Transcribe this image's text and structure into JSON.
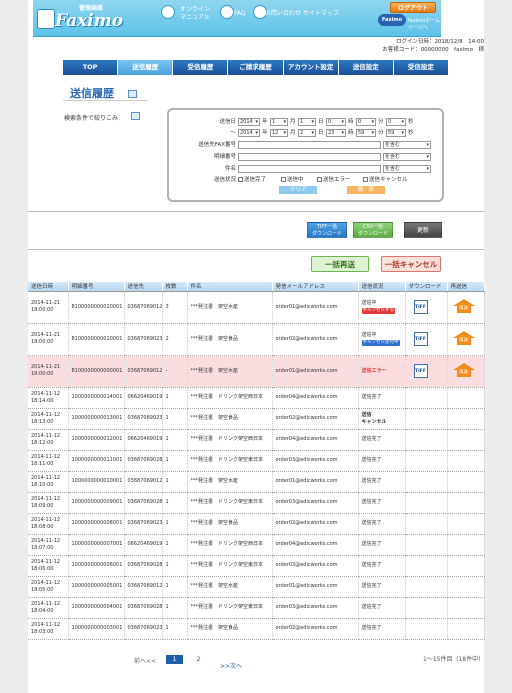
{
  "header": {
    "title_kanri": "管理画面",
    "title_logo": "Faximo",
    "nav_online_manual": "オンライン\nマニュアル",
    "nav_faq": "FAQ",
    "nav_contact_sitemap": "お問い合わせ サイトマップ",
    "logout_label": "ログアウト",
    "home_logo": "Faximo",
    "home_link": "faximoホームページへ"
  },
  "login_info": {
    "login_datetime": "ログイン日時：2018/12/8　14:00",
    "customer": "お客様コード：00000000　faximo　様"
  },
  "tabs": [
    "TOP",
    "送信履歴",
    "受信履歴",
    "ご請求履歴",
    "アカウント設定",
    "送信設定",
    "受信設定"
  ],
  "page_title": "送信履歴",
  "filter_label": "検索条件で絞りこみ",
  "filter": {
    "date_label": "送信日",
    "range_sep": "〜",
    "from": {
      "year": "2014",
      "month": "1",
      "day": "1",
      "hour": "0",
      "min": "0",
      "sec": "0"
    },
    "to": {
      "year": "2014",
      "month": "12",
      "day": "2",
      "hour": "23",
      "min": "59",
      "sec": "59"
    },
    "units": {
      "year": "年",
      "month": "月",
      "day": "日",
      "hour": "時",
      "min": "分",
      "sec": "秒"
    },
    "fax_label": "送信先FAX番号",
    "detail_label": "明細番号",
    "subject_label": "件名",
    "match_option": "を含む",
    "status_label": "送信状況",
    "status_options": [
      "送信完了",
      "送信中",
      "送信エラー",
      "送信キャンセル"
    ],
    "clear_label": "クリア",
    "search_label": "検　索"
  },
  "actions": {
    "tiff_download": "TIFF一括\nダウンロード",
    "csv_download": "CSV一括\nダウンロード",
    "refresh": "更新",
    "bulk_resend": "一括再送",
    "bulk_cancel": "一括キャンセル"
  },
  "table": {
    "headers": [
      "送信日時",
      "明細番号",
      "送信先",
      "枚数",
      "件名",
      "発信メールアドレス",
      "送信状況",
      "ダウンロード",
      "再送信"
    ],
    "rows": [
      {
        "date": "2014-11-21",
        "time": "18:00:00",
        "id": "8100000000020001",
        "dest": "03687069012",
        "pages": "3",
        "subject": "***発注書　架空水産",
        "email": "order01@edicworks.com",
        "status": "送信中",
        "badge": "キャンセルする",
        "tiff": "TIFF",
        "resend": "再送",
        "kind": "sending-cancel"
      },
      {
        "date": "2014-11-21",
        "time": "18:00:00",
        "id": "8100000000010001",
        "dest": "03687069023",
        "pages": "2",
        "subject": "***発注書　架空食品",
        "email": "order02@edicworks.com",
        "status": "送信中",
        "badge": "キャンセル受付中",
        "tiff": "TIFF",
        "resend": "再送",
        "kind": "sending-accept"
      },
      {
        "date": "2014-11-21",
        "time": "18:00:00",
        "id": "8100000000000001",
        "dest": "03687069012",
        "pages": "-",
        "subject": "***発注書　架空水産",
        "email": "order01@edicworks.com",
        "status": "送信エラー",
        "tiff": "TIFF",
        "resend": "再送",
        "kind": "error"
      },
      {
        "date": "2014-11-12",
        "time": "18:14:00",
        "id": "1000000000014001",
        "dest": "06620469019",
        "pages": "1",
        "subject": "***発注書　ドリンク架空西日本",
        "email": "order04@edicworks.com",
        "status": "送信完了",
        "kind": "done"
      },
      {
        "date": "2014-11-12",
        "time": "18:13:00",
        "id": "1000000000013001",
        "dest": "03687069023",
        "pages": "1",
        "subject": "***発注書　架空食品",
        "email": "order02@edicworks.com",
        "status": "送信\nキャンセル",
        "kind": "cancelled"
      },
      {
        "date": "2014-11-12",
        "time": "18:12:00",
        "id": "1000000000012001",
        "dest": "06620469019",
        "pages": "1",
        "subject": "***発注書　ドリンク架空西日本",
        "email": "order04@edicworks.com",
        "status": "送信完了",
        "kind": "done"
      },
      {
        "date": "2014-11-12",
        "time": "18:11:00",
        "id": "1000000000011001",
        "dest": "03687069028",
        "pages": "1",
        "subject": "***発注書　ドリンク架空東日本",
        "email": "order03@edicworks.com",
        "status": "送信完了",
        "kind": "done"
      },
      {
        "date": "2014-11-12",
        "time": "18:10:00",
        "id": "1000000000010001",
        "dest": "03687069012",
        "pages": "1",
        "subject": "***発注書　架空水産",
        "email": "order01@edicworks.com",
        "status": "送信完了",
        "kind": "done"
      },
      {
        "date": "2014-11-12",
        "time": "18:09:00",
        "id": "1000000000009001",
        "dest": "03687069028",
        "pages": "1",
        "subject": "***発注書　ドリンク架空東日本",
        "email": "order03@edicworks.com",
        "status": "送信完了",
        "kind": "done"
      },
      {
        "date": "2014-11-12",
        "time": "18:08:00",
        "id": "1000000000008001",
        "dest": "03687069023",
        "pages": "1",
        "subject": "***発注書　架空食品",
        "email": "order02@edicworks.com",
        "status": "送信完了",
        "kind": "done"
      },
      {
        "date": "2014-11-12",
        "time": "18:07:00",
        "id": "1000000000007001",
        "dest": "06620469019",
        "pages": "1",
        "subject": "***発注書　ドリンク架空西日本",
        "email": "order04@edicworks.com",
        "status": "送信完了",
        "kind": "done"
      },
      {
        "date": "2014-11-12",
        "time": "18:06:00",
        "id": "1000000000006001",
        "dest": "03687069028",
        "pages": "1",
        "subject": "***発注書　ドリンク架空東日本",
        "email": "order03@edicworks.com",
        "status": "送信完了",
        "kind": "done"
      },
      {
        "date": "2014-11-12",
        "time": "18:05:00",
        "id": "1000000000005001",
        "dest": "03687069012",
        "pages": "1",
        "subject": "***発注書　架空水産",
        "email": "order01@edicworks.com",
        "status": "送信完了",
        "kind": "done"
      },
      {
        "date": "2014-11-12",
        "time": "18:04:00",
        "id": "1000000000004001",
        "dest": "03687069028",
        "pages": "1",
        "subject": "***発注書　ドリンク架空東日本",
        "email": "order03@edicworks.com",
        "status": "送信完了",
        "kind": "done"
      },
      {
        "date": "2014-11-12",
        "time": "18:03:00",
        "id": "1000000000003001",
        "dest": "03687069023",
        "pages": "1",
        "subject": "***発注書　架空食品",
        "email": "order02@edicworks.com",
        "status": "送信完了",
        "kind": "done"
      }
    ]
  },
  "pagination": {
    "prev": "前へ<<",
    "pages": [
      "1",
      "2"
    ],
    "current": "1",
    "next": ">>次へ",
    "summary": "1〜15件目（18件中）"
  },
  "colors": {
    "tab": "#1f5ea8",
    "tab_active": "#5aaee4",
    "title": "#2c6bb6",
    "error_row": "#fbdde0",
    "resend_btn": "#f08d1e",
    "bulk_resend_bg": "#dff3d2",
    "bulk_cancel_bg": "#fde1dd"
  }
}
